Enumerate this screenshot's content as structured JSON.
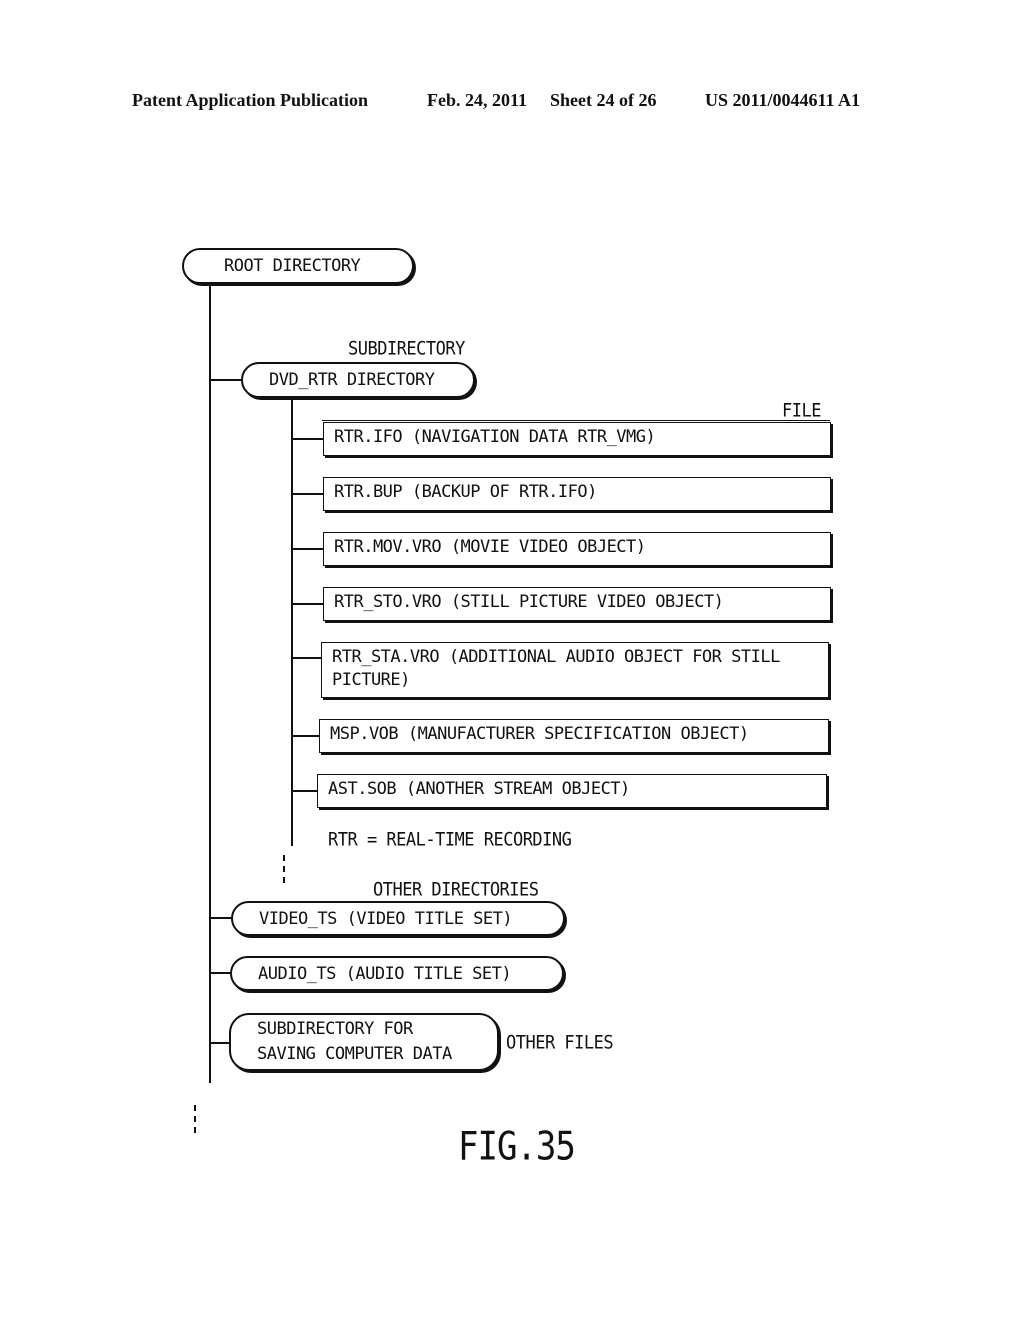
{
  "header": {
    "publication": "Patent Application Publication",
    "date": "Feb. 24, 2011",
    "sheet": "Sheet 24 of 26",
    "patent_number": "US 2011/0044611 A1"
  },
  "diagram": {
    "root": "ROOT DIRECTORY",
    "subdirectory_label": "SUBDIRECTORY",
    "subdirectory": "DVD_RTR DIRECTORY",
    "file_label": "FILE",
    "files": [
      "RTR.IFO (NAVIGATION DATA RTR_VMG)",
      "RTR.BUP (BACKUP OF RTR.IFO)",
      "RTR.MOV.VRO (MOVIE VIDEO OBJECT)",
      "RTR_STO.VRO (STILL PICTURE VIDEO OBJECT)",
      "RTR_STA.VRO (ADDITIONAL AUDIO OBJECT FOR STILL PICTURE)",
      "MSP.VOB (MANUFACTURER SPECIFICATION OBJECT)",
      "AST.SOB (ANOTHER STREAM OBJECT)"
    ],
    "note": "RTR = REAL-TIME RECORDING",
    "other_directories_label": "OTHER DIRECTORIES",
    "other_directories": [
      "VIDEO_TS (VIDEO TITLE SET)",
      "AUDIO_TS (AUDIO TITLE SET)"
    ],
    "computer_data_dir": "SUBDIRECTORY FOR SAVING COMPUTER DATA",
    "other_files_label": "OTHER FILES",
    "figure_label": "FIG.35"
  }
}
